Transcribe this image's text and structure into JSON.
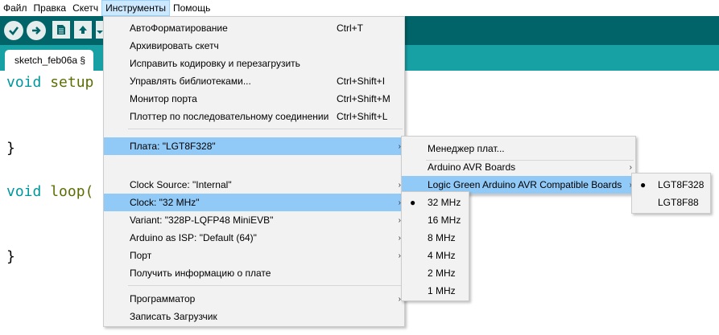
{
  "menubar": {
    "items": [
      "Файл",
      "Правка",
      "Скетч",
      "Инструменты",
      "Помощь"
    ]
  },
  "tab": {
    "label": "sketch_feb06a §"
  },
  "code": {
    "l1_kw": "void",
    "l1_rest": " setup",
    "l2": "}",
    "l3_kw": "void",
    "l3_rest": " loop(",
    "l4": "}"
  },
  "tools_menu": {
    "autoformat": {
      "label": "АвтоФорматирование",
      "shortcut": "Ctrl+T"
    },
    "archive": {
      "label": "Архивировать скетч"
    },
    "fix_encoding": {
      "label": "Исправить кодировку и перезагрузить"
    },
    "manage_libs": {
      "label": "Управлять библиотеками...",
      "shortcut": "Ctrl+Shift+I"
    },
    "serial_monitor": {
      "label": "Монитор порта",
      "shortcut": "Ctrl+Shift+M"
    },
    "serial_plotter": {
      "label": "Плоттер по последовательному соединении",
      "shortcut": "Ctrl+Shift+L"
    },
    "board": {
      "label": "Плата: \"LGT8F328\""
    },
    "clock_source": {
      "label": "Clock Source: \"Internal\""
    },
    "clock": {
      "label": "Clock: \"32 MHz\""
    },
    "variant": {
      "label": "Variant: \"328P-LQFP48 MiniEVB\""
    },
    "isp": {
      "label": "Arduino as ISP: \"Default (64)\""
    },
    "port": {
      "label": "Порт"
    },
    "board_info": {
      "label": "Получить информацию о плате"
    },
    "programmer": {
      "label": "Программатор"
    },
    "burn_bootloader": {
      "label": "Записать Загрузчик"
    }
  },
  "board_menu": {
    "manager": "Менеджер плат...",
    "avr": "Arduino AVR Boards",
    "lgt": "Logic Green Arduino AVR Compatible Boards"
  },
  "lgt_menu": {
    "lgt8f328": "LGT8F328",
    "lgt8f88": "LGT8F88"
  },
  "clock_menu": [
    "32 MHz",
    "16 MHz",
    "8 MHz",
    "4 MHz",
    "2 MHz",
    "1 MHz"
  ],
  "symbols": {
    "bullet": "●",
    "arrow": "›"
  },
  "colors": {
    "toolbar": "#006468",
    "tabrow": "#17a1a5",
    "highlight": "#91c9f7",
    "keyword": "#00979c",
    "function": "#5e6d03"
  }
}
